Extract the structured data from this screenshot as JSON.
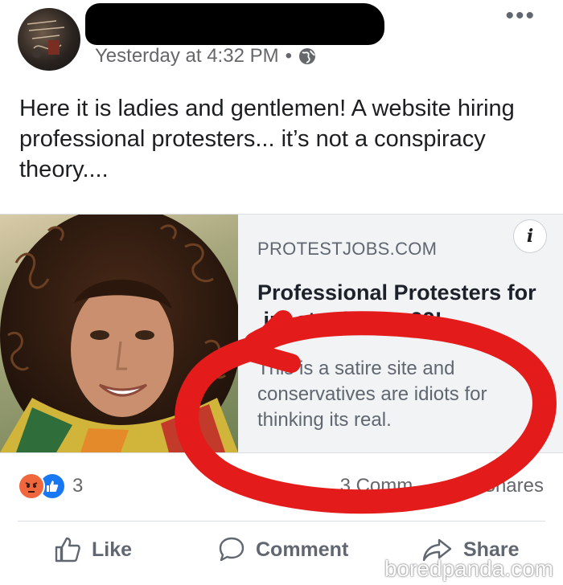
{
  "post": {
    "timestamp": "Yesterday at 4:32 PM",
    "privacy_separator": "•",
    "privacy_icon": "globe-icon",
    "more_label": "•••",
    "text": "Here it is ladies and gentlemen! A website hiring professional protesters... it’s not a conspiracy theory...."
  },
  "link_preview": {
    "domain": "PROTESTJOBS.COM",
    "title": "Professional Protesters for Hire starting at $99!",
    "title_visible": "Professional Protesters for  ire startin        99!",
    "description": "This is a satire site and conservatives are idiots for thinking its real.",
    "info_label": "i"
  },
  "engagement": {
    "reaction_count": "3",
    "comments_shares_visible": "3 Comm          2 Shares"
  },
  "actions": {
    "like_label": "Like",
    "comment_label": "Comment",
    "share_label": "Share"
  },
  "watermark": "boredpanda.com",
  "colors": {
    "annotation_red": "#e31b1b",
    "meta_gray": "#65676b",
    "like_blue": "#1877f2",
    "angry_orange": "#f0673d"
  }
}
